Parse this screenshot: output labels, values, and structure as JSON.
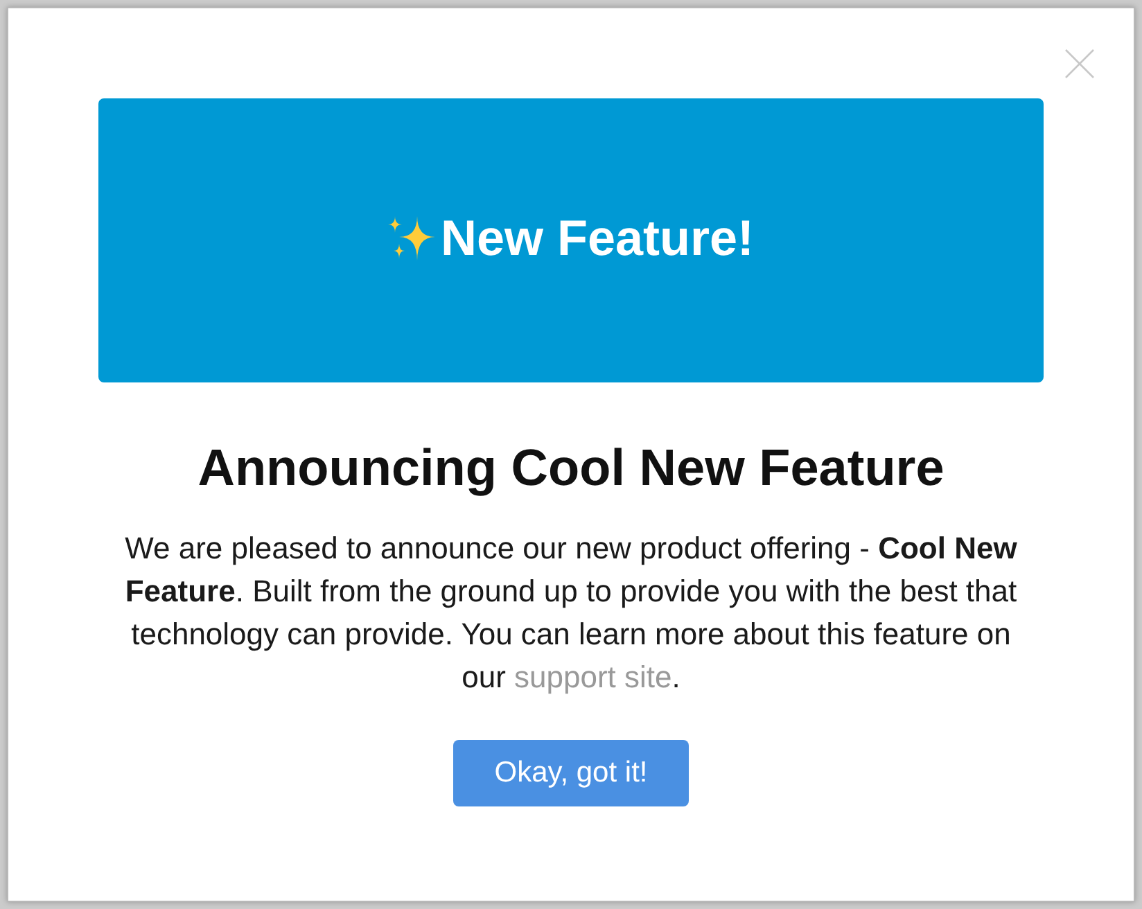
{
  "dialog": {
    "banner": {
      "title": "New Feature!"
    },
    "heading": "Announcing Cool New Feature",
    "message": {
      "text": "We are pleased to announce our new product offering - **Cool New Feature**. Built from the ground up to provide you with the best that technology can provide. You can learn more about this feature on our ",
      "link": "support site",
      "text_end": "."
    },
    "buttons": [
      {
        "label": "Okay, got it!"
      }
    ]
  }
}
